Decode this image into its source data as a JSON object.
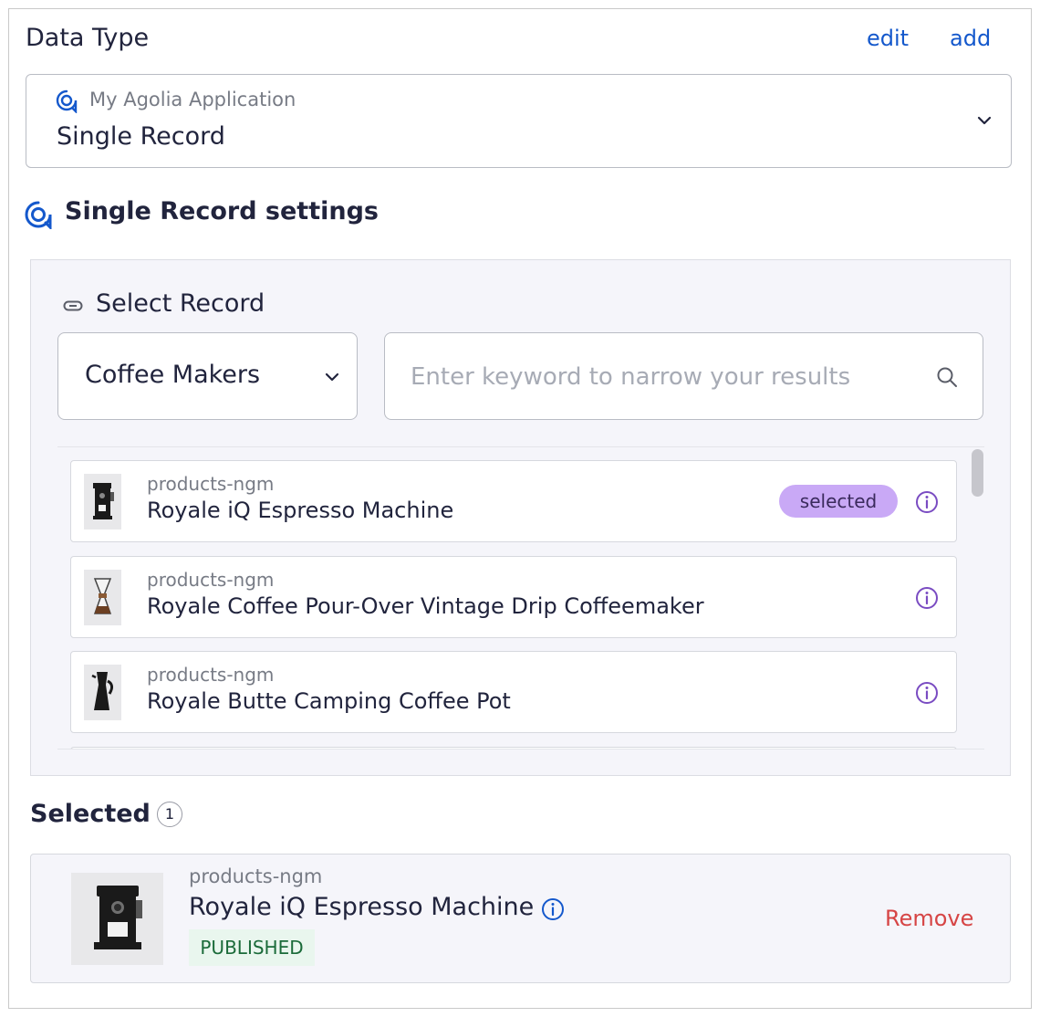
{
  "header": {
    "title": "Data Type",
    "edit_label": "edit",
    "add_label": "add"
  },
  "app_select": {
    "app_name": "My Agolia Application",
    "value": "Single Record"
  },
  "settings": {
    "title": "Single Record settings"
  },
  "select_record": {
    "title": "Select Record",
    "category": "Coffee Makers",
    "search_placeholder": "Enter keyword to narrow your results",
    "records": [
      {
        "index": "products-ngm",
        "title": "Royale iQ Espresso Machine",
        "badge": "selected"
      },
      {
        "index": "products-ngm",
        "title": "Royale Coffee Pour-Over Vintage Drip Coffeemaker"
      },
      {
        "index": "products-ngm",
        "title": "Royale Butte Camping Coffee Pot"
      }
    ]
  },
  "selected": {
    "title": "Selected",
    "count": "1",
    "item": {
      "index": "products-ngm",
      "title": "Royale iQ Espresso Machine",
      "status": "PUBLISHED",
      "remove_label": "Remove"
    }
  },
  "colors": {
    "link": "#1458cc",
    "badge_selected": "#c9a9f6",
    "info_icon": "#7a4cc2",
    "remove": "#d64545",
    "published_bg": "#e9f6ee"
  }
}
